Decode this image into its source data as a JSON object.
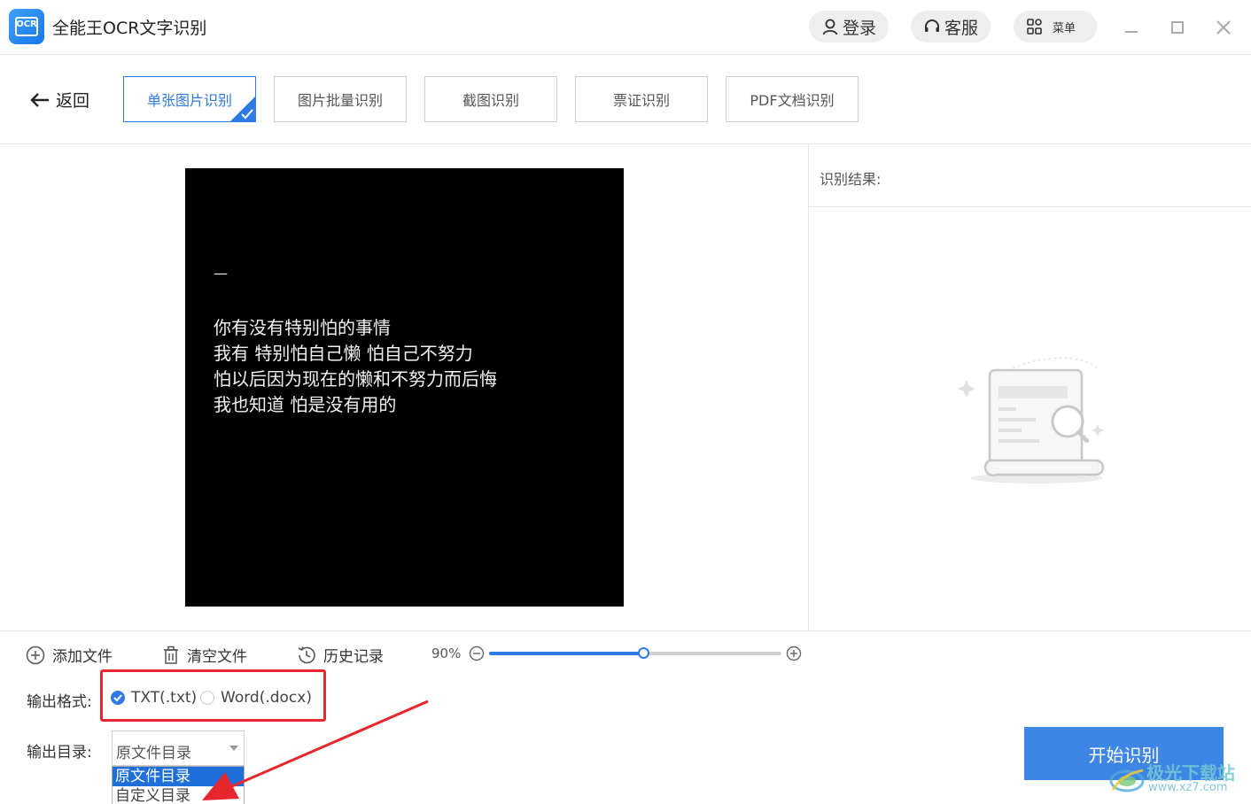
{
  "app": {
    "title": "全能王OCR文字识别",
    "logo_text": "OCR"
  },
  "header": {
    "login_label": "登录",
    "service_label": "客服",
    "menu_label": "菜单"
  },
  "nav": {
    "back_label": "返回",
    "tabs": [
      {
        "label": "单张图片识别",
        "active": true
      },
      {
        "label": "图片批量识别",
        "active": false
      },
      {
        "label": "截图识别",
        "active": false
      },
      {
        "label": "票证识别",
        "active": false
      },
      {
        "label": "PDF文档识别",
        "active": false
      }
    ]
  },
  "preview": {
    "dash": "—",
    "lines": [
      "你有没有特别怕的事情",
      "我有 特别怕自己懒 怕自己不努力",
      "怕以后因为现在的懒和不努力而后悔",
      "我也知道 怕是没有用的"
    ]
  },
  "result": {
    "label": "识别结果:"
  },
  "toolbar": {
    "add_file": "添加文件",
    "clear_files": "清空文件",
    "history": "历史记录",
    "zoom_label": "90%",
    "zoom_fraction": 0.53
  },
  "output": {
    "format_label": "输出格式:",
    "formats": [
      {
        "label": "TXT(.txt)",
        "selected": true
      },
      {
        "label": "Word(.docx)",
        "selected": false
      }
    ],
    "dir_label": "输出目录:",
    "dir_value": "原文件目录",
    "dir_options": [
      "原文件目录",
      "自定义目录"
    ]
  },
  "actions": {
    "start_label": "开始识别"
  },
  "watermark": {
    "line1": "极光下载站",
    "line2": "www.xz7.com"
  },
  "colors": {
    "accent": "#2f7be5",
    "annotation_red": "#e8262d",
    "button_blue": "#3d86e6"
  }
}
